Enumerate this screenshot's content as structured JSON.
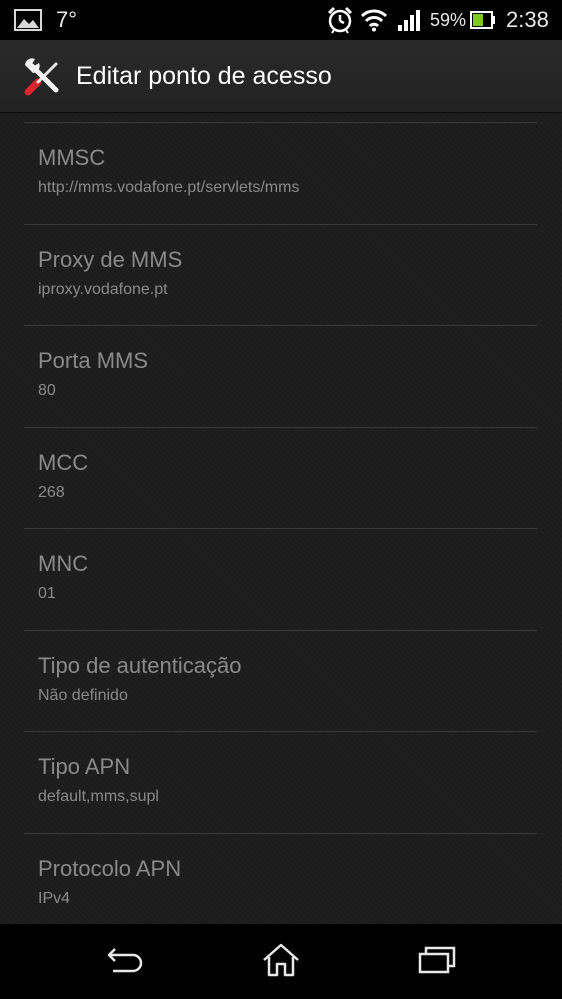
{
  "status_bar": {
    "temperature": "7°",
    "battery_percent": "59%",
    "time": "2:38",
    "icons": [
      "image-notification-icon",
      "alarm-icon",
      "wifi-icon",
      "signal-icon",
      "battery-icon"
    ]
  },
  "action_bar": {
    "title": "Editar ponto de acesso",
    "icon": "tools-icon"
  },
  "preferences": [
    {
      "title": "MMSC",
      "summary": "http://mms.vodafone.pt/servlets/mms"
    },
    {
      "title": "Proxy de MMS",
      "summary": "iproxy.vodafone.pt"
    },
    {
      "title": "Porta MMS",
      "summary": "80"
    },
    {
      "title": "MCC",
      "summary": "268"
    },
    {
      "title": "MNC",
      "summary": "01"
    },
    {
      "title": "Tipo de autenticação",
      "summary": "Não definido"
    },
    {
      "title": "Tipo APN",
      "summary": "default,mms,supl"
    },
    {
      "title": "Protocolo APN",
      "summary": "IPv4"
    }
  ],
  "nav_bar": {
    "buttons": [
      "back-icon",
      "home-icon",
      "recent-apps-icon"
    ]
  },
  "colors": {
    "status_bar_bg": "#000000",
    "action_bar_bg": "#252525",
    "list_bg": "#1c1c1c",
    "text_disabled": "#8a8a8a",
    "divider": "#3a3a3a",
    "battery_fill": "#7ec82a"
  }
}
